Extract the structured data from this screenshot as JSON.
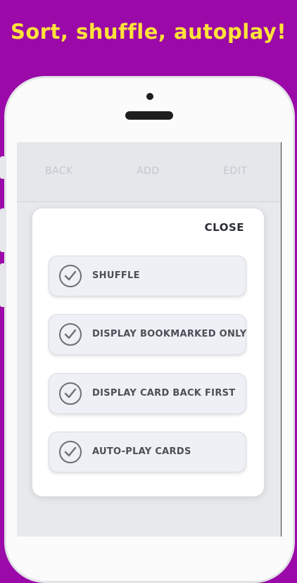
{
  "banner": {
    "headline": "Sort, shuffle, autoplay!"
  },
  "toolbar": {
    "back_label": "BACK",
    "add_label": "ADD",
    "edit_label": "EDIT"
  },
  "modal": {
    "close_label": "CLOSE",
    "options": [
      {
        "label": "SHUFFLE",
        "checked": true,
        "icon": "check-icon"
      },
      {
        "label": "DISPLAY BOOKMARKED ONLY",
        "checked": true,
        "icon": "check-icon"
      },
      {
        "label": "DISPLAY CARD BACK FIRST",
        "checked": true,
        "icon": "check-icon"
      },
      {
        "label": "AUTO-PLAY CARDS",
        "checked": true,
        "icon": "check-icon"
      }
    ]
  },
  "colors": {
    "background": "#9b0aa8",
    "headline": "#ffe23a",
    "option_background": "#eef0f5",
    "check": "#6c6f76"
  }
}
